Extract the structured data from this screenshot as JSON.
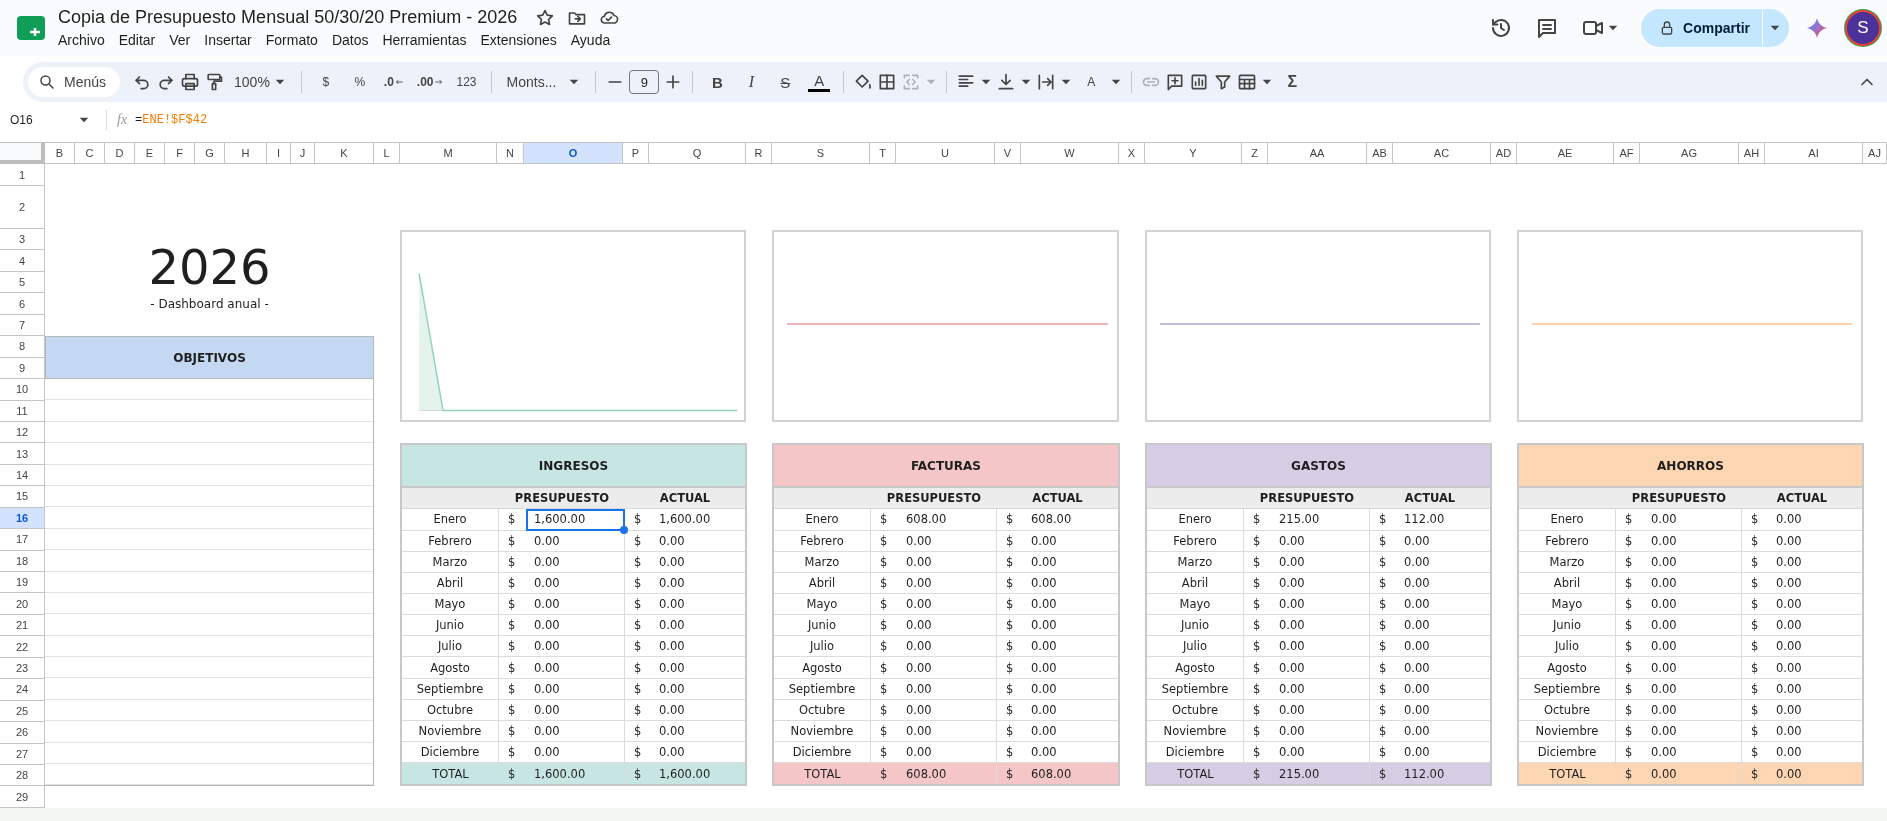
{
  "app": {
    "title": "Copia de Presupuesto Mensual 50/30/20 Premium - 2026",
    "menu": [
      "Archivo",
      "Editar",
      "Ver",
      "Insertar",
      "Formato",
      "Datos",
      "Herramientas",
      "Extensiones",
      "Ayuda"
    ],
    "share_button": "Compartir",
    "avatar": "S"
  },
  "toolbar": {
    "search_label": "Menús",
    "zoom": "100%",
    "currency": "$",
    "percent": "%",
    "decrease_decimals": ".0",
    "increase_decimals": ".00",
    "number_format": "123",
    "font": "Monts...",
    "font_size": "9",
    "bold": "B",
    "italic": "I",
    "strikethrough": "S",
    "text_color": "A",
    "text_rotation": "A",
    "functions": "Σ"
  },
  "formula_bar": {
    "cell": "O16",
    "function_label": "fx",
    "formula_sign": "=",
    "formula_reference": "ENE!$F$42"
  },
  "columns": [
    {
      "label": "B",
      "selected": false
    },
    {
      "label": "C",
      "selected": false
    },
    {
      "label": "D",
      "selected": false
    },
    {
      "label": "E",
      "selected": false
    },
    {
      "label": "F",
      "selected": false
    },
    {
      "label": "G",
      "selected": false
    },
    {
      "label": "H",
      "selected": false
    },
    {
      "label": "I",
      "selected": false
    },
    {
      "label": "J",
      "selected": false
    },
    {
      "label": "K",
      "selected": false
    },
    {
      "label": "L",
      "selected": false
    },
    {
      "label": "M",
      "selected": false
    },
    {
      "label": "N",
      "selected": false
    },
    {
      "label": "O",
      "selected": true
    },
    {
      "label": "P",
      "selected": false
    },
    {
      "label": "Q",
      "selected": false
    },
    {
      "label": "R",
      "selected": false
    },
    {
      "label": "S",
      "selected": false
    },
    {
      "label": "T",
      "selected": false
    },
    {
      "label": "U",
      "selected": false
    },
    {
      "label": "V",
      "selected": false
    },
    {
      "label": "W",
      "selected": false
    },
    {
      "label": "X",
      "selected": false
    },
    {
      "label": "Y",
      "selected": false
    },
    {
      "label": "Z",
      "selected": false
    },
    {
      "label": "AA",
      "selected": false
    },
    {
      "label": "AB",
      "selected": false
    },
    {
      "label": "AC",
      "selected": false
    },
    {
      "label": "AD",
      "selected": false
    },
    {
      "label": "AE",
      "selected": false
    },
    {
      "label": "AF",
      "selected": false
    },
    {
      "label": "AG",
      "selected": false
    },
    {
      "label": "AH",
      "selected": false
    },
    {
      "label": "AI",
      "selected": false
    },
    {
      "label": "AJ",
      "selected": false
    }
  ],
  "rows": [
    {
      "label": "1",
      "selected": false
    },
    {
      "label": "2",
      "selected": false
    },
    {
      "label": "3",
      "selected": false
    },
    {
      "label": "4",
      "selected": false
    },
    {
      "label": "5",
      "selected": false
    },
    {
      "label": "6",
      "selected": false
    },
    {
      "label": "7",
      "selected": false
    },
    {
      "label": "8",
      "selected": false
    },
    {
      "label": "9",
      "selected": false
    },
    {
      "label": "10",
      "selected": false
    },
    {
      "label": "11",
      "selected": false
    },
    {
      "label": "12",
      "selected": false
    },
    {
      "label": "13",
      "selected": false
    },
    {
      "label": "14",
      "selected": false
    },
    {
      "label": "15",
      "selected": false
    },
    {
      "label": "16",
      "selected": true
    },
    {
      "label": "17",
      "selected": false
    },
    {
      "label": "18",
      "selected": false
    },
    {
      "label": "19",
      "selected": false
    },
    {
      "label": "20",
      "selected": false
    },
    {
      "label": "21",
      "selected": false
    },
    {
      "label": "22",
      "selected": false
    },
    {
      "label": "23",
      "selected": false
    },
    {
      "label": "24",
      "selected": false
    },
    {
      "label": "25",
      "selected": false
    },
    {
      "label": "26",
      "selected": false
    },
    {
      "label": "27",
      "selected": false
    },
    {
      "label": "28",
      "selected": false
    },
    {
      "label": "29",
      "selected": false
    }
  ],
  "dashboard": {
    "year": "2026",
    "subtitle": "- Dashboard anual -",
    "objectives_title": "OBJETIVOS"
  },
  "charts": [
    {
      "kind": "area",
      "color": "#93d3b8"
    },
    {
      "kind": "line",
      "color": "#f2b3b5"
    },
    {
      "kind": "line",
      "color": "#c3bbe0"
    },
    {
      "kind": "line",
      "color": "#fbd0ab"
    }
  ],
  "tables": [
    {
      "title": "INGRESOS",
      "color": "#c6e5e3",
      "budget_heading": "PRESUPUESTO",
      "actual_heading": "ACTUAL",
      "rows": [
        {
          "label": "Enero",
          "budget": {
            "currency": "$",
            "value": "1,600.00",
            "selected": true
          },
          "actual": {
            "currency": "$",
            "value": "1,600.00",
            "selected": false
          }
        },
        {
          "label": "Febrero",
          "budget": {
            "currency": "$",
            "value": "0.00",
            "selected": false
          },
          "actual": {
            "currency": "$",
            "value": "0.00",
            "selected": false
          }
        },
        {
          "label": "Marzo",
          "budget": {
            "currency": "$",
            "value": "0.00",
            "selected": false
          },
          "actual": {
            "currency": "$",
            "value": "0.00",
            "selected": false
          }
        },
        {
          "label": "Abril",
          "budget": {
            "currency": "$",
            "value": "0.00",
            "selected": false
          },
          "actual": {
            "currency": "$",
            "value": "0.00",
            "selected": false
          }
        },
        {
          "label": "Mayo",
          "budget": {
            "currency": "$",
            "value": "0.00",
            "selected": false
          },
          "actual": {
            "currency": "$",
            "value": "0.00",
            "selected": false
          }
        },
        {
          "label": "Junio",
          "budget": {
            "currency": "$",
            "value": "0.00",
            "selected": false
          },
          "actual": {
            "currency": "$",
            "value": "0.00",
            "selected": false
          }
        },
        {
          "label": "Julio",
          "budget": {
            "currency": "$",
            "value": "0.00",
            "selected": false
          },
          "actual": {
            "currency": "$",
            "value": "0.00",
            "selected": false
          }
        },
        {
          "label": "Agosto",
          "budget": {
            "currency": "$",
            "value": "0.00",
            "selected": false
          },
          "actual": {
            "currency": "$",
            "value": "0.00",
            "selected": false
          }
        },
        {
          "label": "Septiembre",
          "budget": {
            "currency": "$",
            "value": "0.00",
            "selected": false
          },
          "actual": {
            "currency": "$",
            "value": "0.00",
            "selected": false
          }
        },
        {
          "label": "Octubre",
          "budget": {
            "currency": "$",
            "value": "0.00",
            "selected": false
          },
          "actual": {
            "currency": "$",
            "value": "0.00",
            "selected": false
          }
        },
        {
          "label": "Noviembre",
          "budget": {
            "currency": "$",
            "value": "0.00",
            "selected": false
          },
          "actual": {
            "currency": "$",
            "value": "0.00",
            "selected": false
          }
        },
        {
          "label": "Diciembre",
          "budget": {
            "currency": "$",
            "value": "0.00",
            "selected": false
          },
          "actual": {
            "currency": "$",
            "value": "0.00",
            "selected": false
          }
        }
      ],
      "total": {
        "label": "TOTAL",
        "budget": {
          "currency": "$",
          "value": "1,600.00"
        },
        "actual": {
          "currency": "$",
          "value": "1,600.00"
        }
      }
    },
    {
      "title": "FACTURAS",
      "color": "#f4c6c8",
      "budget_heading": "PRESUPUESTO",
      "actual_heading": "ACTUAL",
      "rows": [
        {
          "label": "Enero",
          "budget": {
            "currency": "$",
            "value": "608.00",
            "selected": false
          },
          "actual": {
            "currency": "$",
            "value": "608.00",
            "selected": false
          }
        },
        {
          "label": "Febrero",
          "budget": {
            "currency": "$",
            "value": "0.00",
            "selected": false
          },
          "actual": {
            "currency": "$",
            "value": "0.00",
            "selected": false
          }
        },
        {
          "label": "Marzo",
          "budget": {
            "currency": "$",
            "value": "0.00",
            "selected": false
          },
          "actual": {
            "currency": "$",
            "value": "0.00",
            "selected": false
          }
        },
        {
          "label": "Abril",
          "budget": {
            "currency": "$",
            "value": "0.00",
            "selected": false
          },
          "actual": {
            "currency": "$",
            "value": "0.00",
            "selected": false
          }
        },
        {
          "label": "Mayo",
          "budget": {
            "currency": "$",
            "value": "0.00",
            "selected": false
          },
          "actual": {
            "currency": "$",
            "value": "0.00",
            "selected": false
          }
        },
        {
          "label": "Junio",
          "budget": {
            "currency": "$",
            "value": "0.00",
            "selected": false
          },
          "actual": {
            "currency": "$",
            "value": "0.00",
            "selected": false
          }
        },
        {
          "label": "Julio",
          "budget": {
            "currency": "$",
            "value": "0.00",
            "selected": false
          },
          "actual": {
            "currency": "$",
            "value": "0.00",
            "selected": false
          }
        },
        {
          "label": "Agosto",
          "budget": {
            "currency": "$",
            "value": "0.00",
            "selected": false
          },
          "actual": {
            "currency": "$",
            "value": "0.00",
            "selected": false
          }
        },
        {
          "label": "Septiembre",
          "budget": {
            "currency": "$",
            "value": "0.00",
            "selected": false
          },
          "actual": {
            "currency": "$",
            "value": "0.00",
            "selected": false
          }
        },
        {
          "label": "Octubre",
          "budget": {
            "currency": "$",
            "value": "0.00",
            "selected": false
          },
          "actual": {
            "currency": "$",
            "value": "0.00",
            "selected": false
          }
        },
        {
          "label": "Noviembre",
          "budget": {
            "currency": "$",
            "value": "0.00",
            "selected": false
          },
          "actual": {
            "currency": "$",
            "value": "0.00",
            "selected": false
          }
        },
        {
          "label": "Diciembre",
          "budget": {
            "currency": "$",
            "value": "0.00",
            "selected": false
          },
          "actual": {
            "currency": "$",
            "value": "0.00",
            "selected": false
          }
        }
      ],
      "total": {
        "label": "TOTAL",
        "budget": {
          "currency": "$",
          "value": "608.00"
        },
        "actual": {
          "currency": "$",
          "value": "608.00"
        }
      }
    },
    {
      "title": "GASTOS",
      "color": "#d6cde5",
      "budget_heading": "PRESUPUESTO",
      "actual_heading": "ACTUAL",
      "rows": [
        {
          "label": "Enero",
          "budget": {
            "currency": "$",
            "value": "215.00",
            "selected": false
          },
          "actual": {
            "currency": "$",
            "value": "112.00",
            "selected": false
          }
        },
        {
          "label": "Febrero",
          "budget": {
            "currency": "$",
            "value": "0.00",
            "selected": false
          },
          "actual": {
            "currency": "$",
            "value": "0.00",
            "selected": false
          }
        },
        {
          "label": "Marzo",
          "budget": {
            "currency": "$",
            "value": "0.00",
            "selected": false
          },
          "actual": {
            "currency": "$",
            "value": "0.00",
            "selected": false
          }
        },
        {
          "label": "Abril",
          "budget": {
            "currency": "$",
            "value": "0.00",
            "selected": false
          },
          "actual": {
            "currency": "$",
            "value": "0.00",
            "selected": false
          }
        },
        {
          "label": "Mayo",
          "budget": {
            "currency": "$",
            "value": "0.00",
            "selected": false
          },
          "actual": {
            "currency": "$",
            "value": "0.00",
            "selected": false
          }
        },
        {
          "label": "Junio",
          "budget": {
            "currency": "$",
            "value": "0.00",
            "selected": false
          },
          "actual": {
            "currency": "$",
            "value": "0.00",
            "selected": false
          }
        },
        {
          "label": "Julio",
          "budget": {
            "currency": "$",
            "value": "0.00",
            "selected": false
          },
          "actual": {
            "currency": "$",
            "value": "0.00",
            "selected": false
          }
        },
        {
          "label": "Agosto",
          "budget": {
            "currency": "$",
            "value": "0.00",
            "selected": false
          },
          "actual": {
            "currency": "$",
            "value": "0.00",
            "selected": false
          }
        },
        {
          "label": "Septiembre",
          "budget": {
            "currency": "$",
            "value": "0.00",
            "selected": false
          },
          "actual": {
            "currency": "$",
            "value": "0.00",
            "selected": false
          }
        },
        {
          "label": "Octubre",
          "budget": {
            "currency": "$",
            "value": "0.00",
            "selected": false
          },
          "actual": {
            "currency": "$",
            "value": "0.00",
            "selected": false
          }
        },
        {
          "label": "Noviembre",
          "budget": {
            "currency": "$",
            "value": "0.00",
            "selected": false
          },
          "actual": {
            "currency": "$",
            "value": "0.00",
            "selected": false
          }
        },
        {
          "label": "Diciembre",
          "budget": {
            "currency": "$",
            "value": "0.00",
            "selected": false
          },
          "actual": {
            "currency": "$",
            "value": "0.00",
            "selected": false
          }
        }
      ],
      "total": {
        "label": "TOTAL",
        "budget": {
          "currency": "$",
          "value": "215.00"
        },
        "actual": {
          "currency": "$",
          "value": "112.00"
        }
      }
    },
    {
      "title": "AHORROS",
      "color": "#fcd5b3",
      "budget_heading": "PRESUPUESTO",
      "actual_heading": "ACTUAL",
      "rows": [
        {
          "label": "Enero",
          "budget": {
            "currency": "$",
            "value": "0.00",
            "selected": false
          },
          "actual": {
            "currency": "$",
            "value": "0.00",
            "selected": false
          }
        },
        {
          "label": "Febrero",
          "budget": {
            "currency": "$",
            "value": "0.00",
            "selected": false
          },
          "actual": {
            "currency": "$",
            "value": "0.00",
            "selected": false
          }
        },
        {
          "label": "Marzo",
          "budget": {
            "currency": "$",
            "value": "0.00",
            "selected": false
          },
          "actual": {
            "currency": "$",
            "value": "0.00",
            "selected": false
          }
        },
        {
          "label": "Abril",
          "budget": {
            "currency": "$",
            "value": "0.00",
            "selected": false
          },
          "actual": {
            "currency": "$",
            "value": "0.00",
            "selected": false
          }
        },
        {
          "label": "Mayo",
          "budget": {
            "currency": "$",
            "value": "0.00",
            "selected": false
          },
          "actual": {
            "currency": "$",
            "value": "0.00",
            "selected": false
          }
        },
        {
          "label": "Junio",
          "budget": {
            "currency": "$",
            "value": "0.00",
            "selected": false
          },
          "actual": {
            "currency": "$",
            "value": "0.00",
            "selected": false
          }
        },
        {
          "label": "Julio",
          "budget": {
            "currency": "$",
            "value": "0.00",
            "selected": false
          },
          "actual": {
            "currency": "$",
            "value": "0.00",
            "selected": false
          }
        },
        {
          "label": "Agosto",
          "budget": {
            "currency": "$",
            "value": "0.00",
            "selected": false
          },
          "actual": {
            "currency": "$",
            "value": "0.00",
            "selected": false
          }
        },
        {
          "label": "Septiembre",
          "budget": {
            "currency": "$",
            "value": "0.00",
            "selected": false
          },
          "actual": {
            "currency": "$",
            "value": "0.00",
            "selected": false
          }
        },
        {
          "label": "Octubre",
          "budget": {
            "currency": "$",
            "value": "0.00",
            "selected": false
          },
          "actual": {
            "currency": "$",
            "value": "0.00",
            "selected": false
          }
        },
        {
          "label": "Noviembre",
          "budget": {
            "currency": "$",
            "value": "0.00",
            "selected": false
          },
          "actual": {
            "currency": "$",
            "value": "0.00",
            "selected": false
          }
        },
        {
          "label": "Diciembre",
          "budget": {
            "currency": "$",
            "value": "0.00",
            "selected": false
          },
          "actual": {
            "currency": "$",
            "value": "0.00",
            "selected": false
          }
        }
      ],
      "total": {
        "label": "TOTAL",
        "budget": {
          "currency": "$",
          "value": "0.00"
        },
        "actual": {
          "currency": "$",
          "value": "0.00"
        }
      }
    }
  ]
}
